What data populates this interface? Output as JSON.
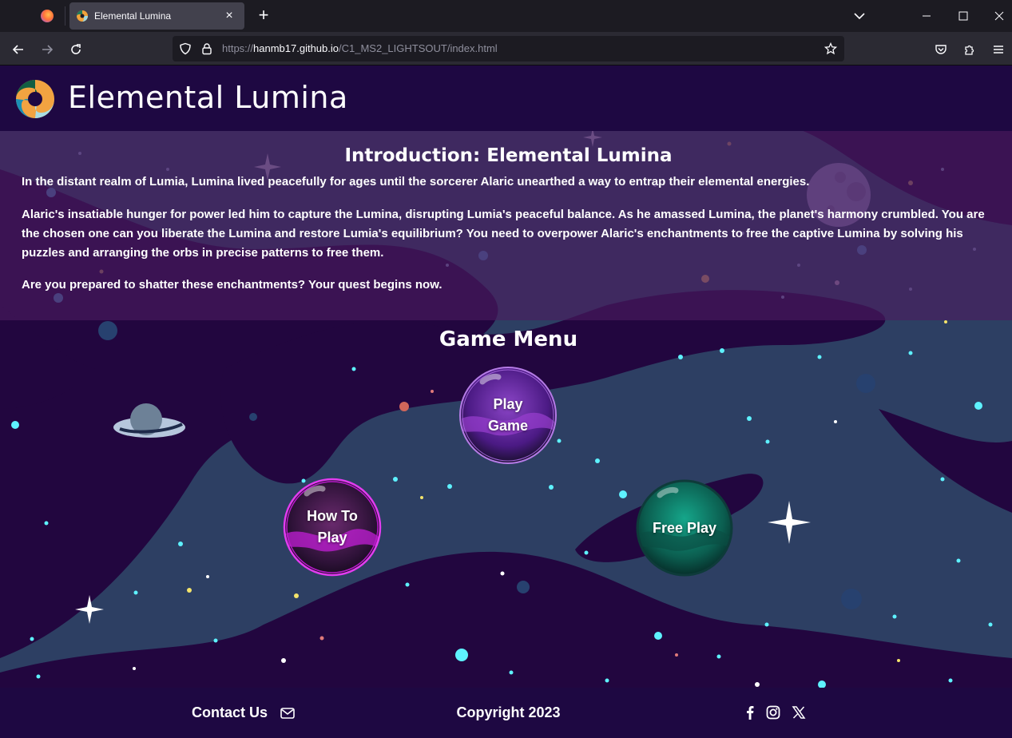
{
  "browser": {
    "tab_title": "Elemental Lumina",
    "url_prefix": "https://",
    "url_host": "hanmb17.github.io",
    "url_path": "/C1_MS2_LIGHTSOUT/index.html",
    "new_tab_glyph": "+",
    "close_glyph": "×"
  },
  "site": {
    "title": "Elemental Lumina",
    "logo_icon": "swirl-logo-icon"
  },
  "intro": {
    "title": "Introduction: Elemental Lumina",
    "paragraphs": [
      "In the distant realm of Lumia, Lumina lived peacefully for ages until the sorcerer Alaric unearthed a way to entrap their elemental energies.",
      "Alaric's insatiable hunger for power led him to capture the Lumina, disrupting Lumia's peaceful balance. As he amassed Lumina, the planet's harmony crumbled. You are the chosen one can you liberate the Lumina and restore Lumia's equilibrium? You need to overpower Alaric's enchantments to free the captive Lumina by solving his puzzles and arranging the orbs in precise patterns to free them.",
      "Are you prepared to shatter these enchantments? Your quest begins now."
    ]
  },
  "menu": {
    "title": "Game Menu",
    "play_game": "Play Game",
    "how_to_play": "How To Play",
    "free_play": "Free Play"
  },
  "footer": {
    "contact": "Contact Us",
    "copyright": "Copyright 2023",
    "icons": [
      "envelope-icon",
      "facebook-icon",
      "instagram-icon",
      "x-icon"
    ]
  },
  "colors": {
    "header_bg": "#1e0842",
    "space_bg": "#2d3f63",
    "nebula": "#22063f",
    "intro_overlay": "#4a1c60",
    "play_orb": "#6a2aa8",
    "how_orb": "#c21fd6",
    "free_orb": "#0b7a66"
  }
}
